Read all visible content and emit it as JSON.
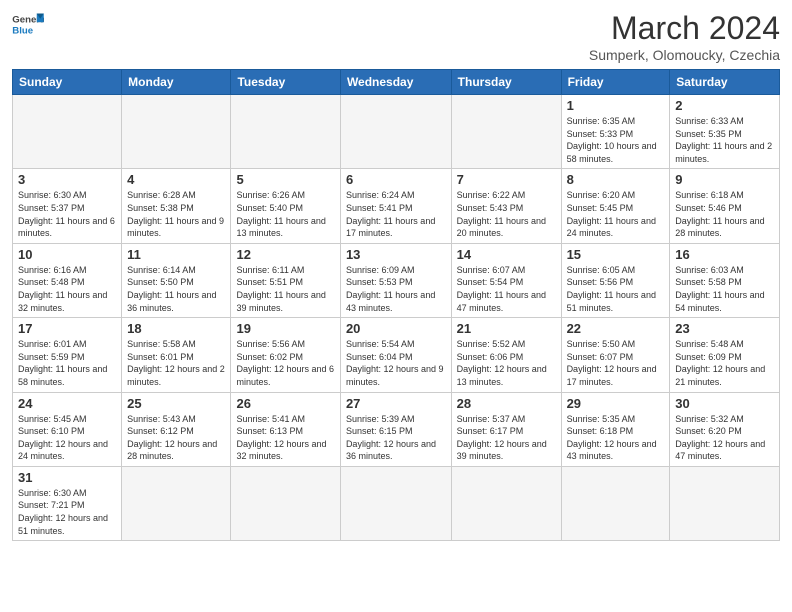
{
  "header": {
    "logo_general": "General",
    "logo_blue": "Blue",
    "month_year": "March 2024",
    "location": "Sumperk, Olomoucky, Czechia"
  },
  "days_of_week": [
    "Sunday",
    "Monday",
    "Tuesday",
    "Wednesday",
    "Thursday",
    "Friday",
    "Saturday"
  ],
  "weeks": [
    [
      {
        "day": "",
        "info": "",
        "empty": true
      },
      {
        "day": "",
        "info": "",
        "empty": true
      },
      {
        "day": "",
        "info": "",
        "empty": true
      },
      {
        "day": "",
        "info": "",
        "empty": true
      },
      {
        "day": "",
        "info": "",
        "empty": true
      },
      {
        "day": "1",
        "info": "Sunrise: 6:35 AM\nSunset: 5:33 PM\nDaylight: 10 hours and 58 minutes."
      },
      {
        "day": "2",
        "info": "Sunrise: 6:33 AM\nSunset: 5:35 PM\nDaylight: 11 hours and 2 minutes."
      }
    ],
    [
      {
        "day": "3",
        "info": "Sunrise: 6:30 AM\nSunset: 5:37 PM\nDaylight: 11 hours and 6 minutes."
      },
      {
        "day": "4",
        "info": "Sunrise: 6:28 AM\nSunset: 5:38 PM\nDaylight: 11 hours and 9 minutes."
      },
      {
        "day": "5",
        "info": "Sunrise: 6:26 AM\nSunset: 5:40 PM\nDaylight: 11 hours and 13 minutes."
      },
      {
        "day": "6",
        "info": "Sunrise: 6:24 AM\nSunset: 5:41 PM\nDaylight: 11 hours and 17 minutes."
      },
      {
        "day": "7",
        "info": "Sunrise: 6:22 AM\nSunset: 5:43 PM\nDaylight: 11 hours and 20 minutes."
      },
      {
        "day": "8",
        "info": "Sunrise: 6:20 AM\nSunset: 5:45 PM\nDaylight: 11 hours and 24 minutes."
      },
      {
        "day": "9",
        "info": "Sunrise: 6:18 AM\nSunset: 5:46 PM\nDaylight: 11 hours and 28 minutes."
      }
    ],
    [
      {
        "day": "10",
        "info": "Sunrise: 6:16 AM\nSunset: 5:48 PM\nDaylight: 11 hours and 32 minutes."
      },
      {
        "day": "11",
        "info": "Sunrise: 6:14 AM\nSunset: 5:50 PM\nDaylight: 11 hours and 36 minutes."
      },
      {
        "day": "12",
        "info": "Sunrise: 6:11 AM\nSunset: 5:51 PM\nDaylight: 11 hours and 39 minutes."
      },
      {
        "day": "13",
        "info": "Sunrise: 6:09 AM\nSunset: 5:53 PM\nDaylight: 11 hours and 43 minutes."
      },
      {
        "day": "14",
        "info": "Sunrise: 6:07 AM\nSunset: 5:54 PM\nDaylight: 11 hours and 47 minutes."
      },
      {
        "day": "15",
        "info": "Sunrise: 6:05 AM\nSunset: 5:56 PM\nDaylight: 11 hours and 51 minutes."
      },
      {
        "day": "16",
        "info": "Sunrise: 6:03 AM\nSunset: 5:58 PM\nDaylight: 11 hours and 54 minutes."
      }
    ],
    [
      {
        "day": "17",
        "info": "Sunrise: 6:01 AM\nSunset: 5:59 PM\nDaylight: 11 hours and 58 minutes."
      },
      {
        "day": "18",
        "info": "Sunrise: 5:58 AM\nSunset: 6:01 PM\nDaylight: 12 hours and 2 minutes."
      },
      {
        "day": "19",
        "info": "Sunrise: 5:56 AM\nSunset: 6:02 PM\nDaylight: 12 hours and 6 minutes."
      },
      {
        "day": "20",
        "info": "Sunrise: 5:54 AM\nSunset: 6:04 PM\nDaylight: 12 hours and 9 minutes."
      },
      {
        "day": "21",
        "info": "Sunrise: 5:52 AM\nSunset: 6:06 PM\nDaylight: 12 hours and 13 minutes."
      },
      {
        "day": "22",
        "info": "Sunrise: 5:50 AM\nSunset: 6:07 PM\nDaylight: 12 hours and 17 minutes."
      },
      {
        "day": "23",
        "info": "Sunrise: 5:48 AM\nSunset: 6:09 PM\nDaylight: 12 hours and 21 minutes."
      }
    ],
    [
      {
        "day": "24",
        "info": "Sunrise: 5:45 AM\nSunset: 6:10 PM\nDaylight: 12 hours and 24 minutes."
      },
      {
        "day": "25",
        "info": "Sunrise: 5:43 AM\nSunset: 6:12 PM\nDaylight: 12 hours and 28 minutes."
      },
      {
        "day": "26",
        "info": "Sunrise: 5:41 AM\nSunset: 6:13 PM\nDaylight: 12 hours and 32 minutes."
      },
      {
        "day": "27",
        "info": "Sunrise: 5:39 AM\nSunset: 6:15 PM\nDaylight: 12 hours and 36 minutes."
      },
      {
        "day": "28",
        "info": "Sunrise: 5:37 AM\nSunset: 6:17 PM\nDaylight: 12 hours and 39 minutes."
      },
      {
        "day": "29",
        "info": "Sunrise: 5:35 AM\nSunset: 6:18 PM\nDaylight: 12 hours and 43 minutes."
      },
      {
        "day": "30",
        "info": "Sunrise: 5:32 AM\nSunset: 6:20 PM\nDaylight: 12 hours and 47 minutes."
      }
    ],
    [
      {
        "day": "31",
        "info": "Sunrise: 6:30 AM\nSunset: 7:21 PM\nDaylight: 12 hours and 51 minutes."
      },
      {
        "day": "",
        "info": "",
        "empty": true
      },
      {
        "day": "",
        "info": "",
        "empty": true
      },
      {
        "day": "",
        "info": "",
        "empty": true
      },
      {
        "day": "",
        "info": "",
        "empty": true
      },
      {
        "day": "",
        "info": "",
        "empty": true
      },
      {
        "day": "",
        "info": "",
        "empty": true
      }
    ]
  ]
}
